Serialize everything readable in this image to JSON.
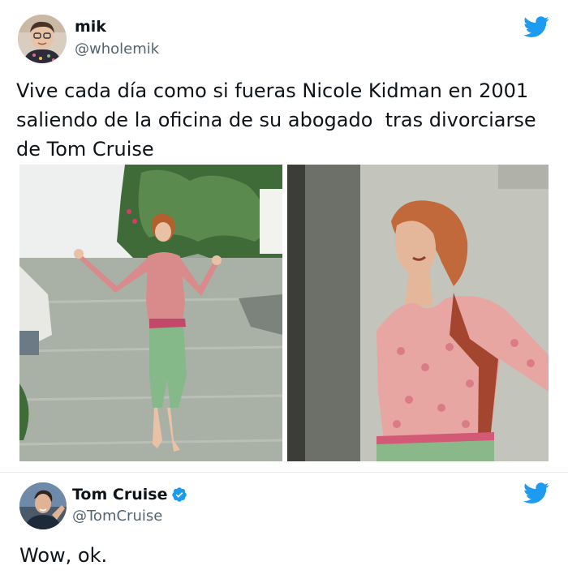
{
  "tweet1": {
    "author_name": "mik",
    "author_handle": "@wholemik",
    "text": "Vive cada día como si fueras Nicole Kidman en 2001\nsaliendo de la oficina de su abogado  tras divorciarse\nde Tom Cruise",
    "icon": "twitter-bird-icon",
    "media": [
      {
        "description_name": "photo-walking-street"
      },
      {
        "description_name": "photo-arms-spread-closeup"
      }
    ]
  },
  "tweet2": {
    "author_name": "Tom Cruise",
    "author_handle": "@TomCruise",
    "verified": true,
    "text": "Wow, ok.",
    "icon": "twitter-bird-icon"
  },
  "colors": {
    "twitter_blue": "#1d9bf0",
    "text": "#0f1419",
    "secondary_text": "#536471"
  }
}
